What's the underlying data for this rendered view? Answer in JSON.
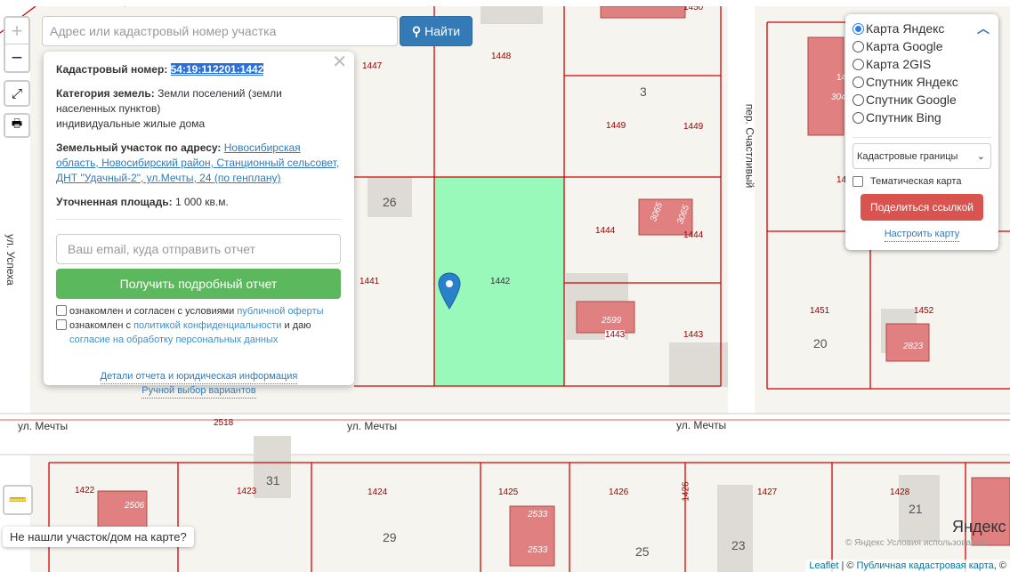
{
  "search": {
    "placeholder": "Адрес или кадастровый номер участка",
    "button": "Найти"
  },
  "zoom": {
    "in": "+",
    "out": "−"
  },
  "popup": {
    "cadnum_label": "Кадастровый номер:",
    "cadnum": "54:19:112201:1442",
    "category_label": "Категория земель:",
    "category": "Земли поселений (земли населенных пунктов)",
    "use": "индивидуальные жилые дома",
    "address_label": "Земельный участок по адресу:",
    "address": "Новосибирская область, Новосибирский район, Станционный сельсовет, ДНТ \"Удачный-2\", ул.Мечты, 24 (по генплану)",
    "area_label": "Уточненная площадь:",
    "area": "1 000 кв.м.",
    "email_placeholder": "Ваш email, куда отправить отчет",
    "report_button": "Получить подробный отчет",
    "agree1_text": "ознакомлен и согласен с условиями",
    "agree1_link": "публичной оферты",
    "agree2_text": "ознакомлен с",
    "agree2_link": "политикой конфиденциальности",
    "agree2_mid": "и даю",
    "agree2_link2": "согласие на обработку персональных данных",
    "details_link": "Детали отчета и юридическая информация",
    "manual_link": "Ручной выбор вариантов"
  },
  "layers": {
    "options": [
      "Карта Яндекс",
      "Карта Google",
      "Карта 2GIS",
      "Спутник Яндекс",
      "Спутник Google",
      "Спутник Bing"
    ],
    "selected": 0,
    "overlay": "Кадастровые границы",
    "thematic": "Тематическая карта",
    "share": "Поделиться ссылкой",
    "settings": "Настроить карту"
  },
  "map": {
    "parcels": [
      "1450",
      "1448",
      "1447",
      "1449",
      "1449",
      "1444",
      "1444",
      "1442",
      "1441",
      "1443",
      "1443",
      "1451",
      "1452",
      "2518",
      "1422",
      "1423",
      "1424",
      "1425",
      "1426",
      "1426",
      "1427",
      "1428",
      "14",
      "14"
    ],
    "blocks": [
      "3",
      "26",
      "20",
      "31",
      "29",
      "25",
      "23",
      "21"
    ],
    "streets": [
      "ул. Мечты",
      "ул. Мечты",
      "ул. Мечты",
      "ул. Успеха",
      "пер. Счастливый"
    ],
    "buildings": [
      "3065",
      "3065",
      "2599",
      "2823",
      "2506",
      "2533",
      "2533",
      "304"
    ],
    "yandex_logo": "Яндекс",
    "yandex_terms": "© Яндекс  Условия использования"
  },
  "attribution": {
    "leaflet": "Leaflet",
    "sep": " | © ",
    "pkk": "Публичная кадастровая карта",
    "tail": ", ©"
  },
  "not_found": "Не нашли участок/дом на карте?",
  "colors": {
    "plot": "#99f9bb",
    "border": "#d40000",
    "building": "#e08080",
    "primary": "#337ab7",
    "success": "#5cb85c",
    "danger": "#d9534f"
  }
}
